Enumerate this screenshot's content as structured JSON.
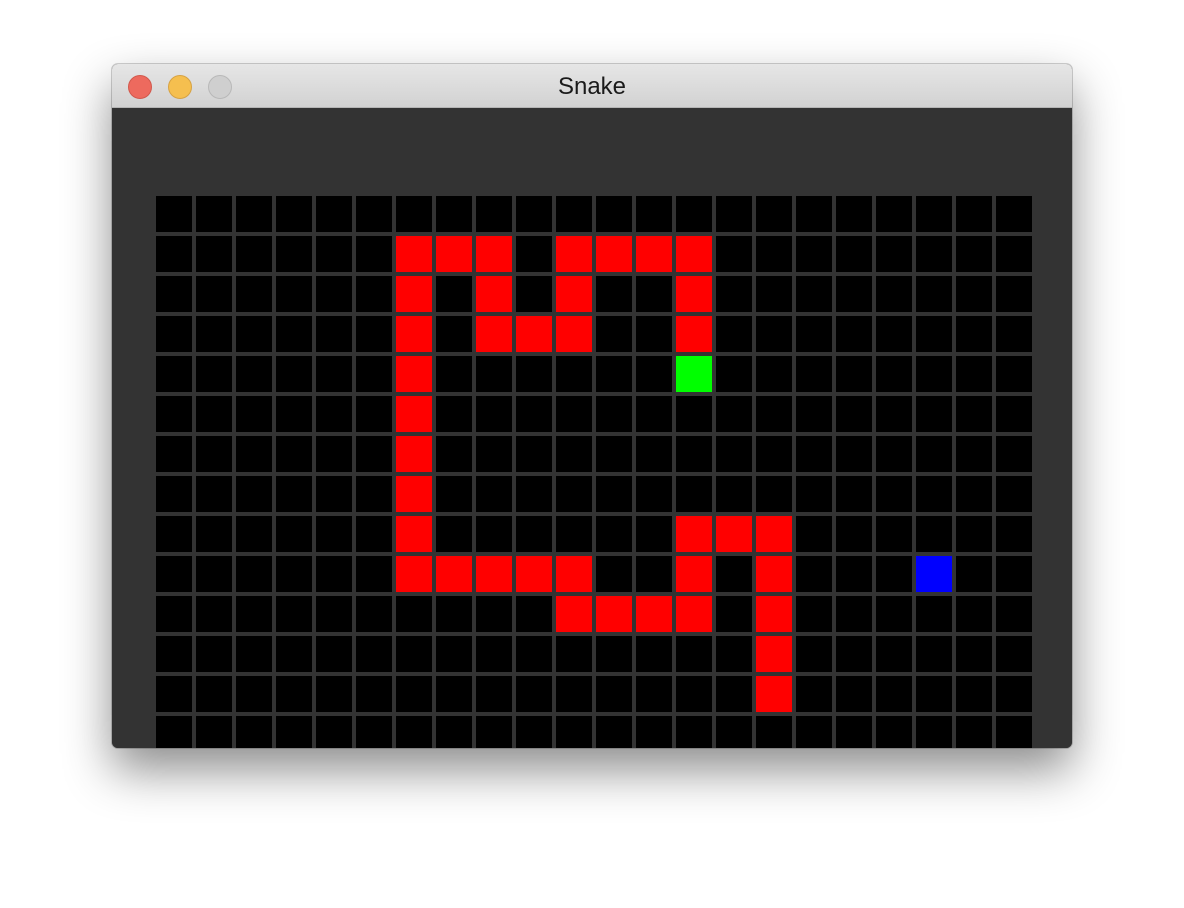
{
  "window": {
    "title": "Snake"
  },
  "colors": {
    "background": "#000000",
    "gridline": "#333333",
    "snake": "#ff0000",
    "head": "#00ff00",
    "food": "#0000ff"
  },
  "board": {
    "cols": 22,
    "rows": 14,
    "snake": [
      [
        6,
        1
      ],
      [
        7,
        1
      ],
      [
        8,
        1
      ],
      [
        10,
        1
      ],
      [
        11,
        1
      ],
      [
        12,
        1
      ],
      [
        13,
        1
      ],
      [
        6,
        2
      ],
      [
        8,
        2
      ],
      [
        10,
        2
      ],
      [
        13,
        2
      ],
      [
        6,
        3
      ],
      [
        8,
        3
      ],
      [
        9,
        3
      ],
      [
        10,
        3
      ],
      [
        13,
        3
      ],
      [
        6,
        4
      ],
      [
        6,
        5
      ],
      [
        6,
        6
      ],
      [
        6,
        7
      ],
      [
        6,
        8
      ],
      [
        13,
        8
      ],
      [
        14,
        8
      ],
      [
        15,
        8
      ],
      [
        6,
        9
      ],
      [
        7,
        9
      ],
      [
        8,
        9
      ],
      [
        9,
        9
      ],
      [
        10,
        9
      ],
      [
        13,
        9
      ],
      [
        15,
        9
      ],
      [
        10,
        10
      ],
      [
        11,
        10
      ],
      [
        12,
        10
      ],
      [
        13,
        10
      ],
      [
        15,
        10
      ],
      [
        15,
        11
      ],
      [
        15,
        12
      ]
    ],
    "head": [
      13,
      4
    ],
    "food": [
      19,
      9
    ]
  }
}
